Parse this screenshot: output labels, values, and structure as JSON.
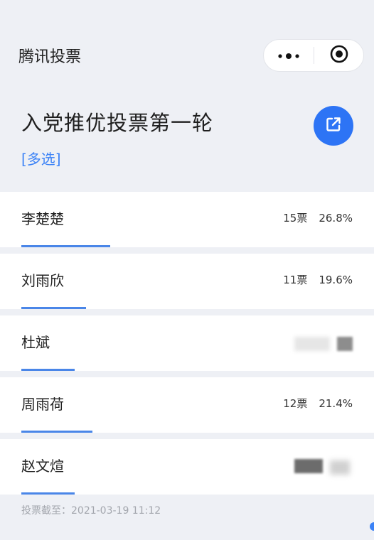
{
  "header": {
    "app_title": "腾讯投票",
    "more_icon": "more-dots-icon",
    "close_icon": "target-close-icon"
  },
  "poll": {
    "title": "入党推优投票第一轮",
    "type_label": "[多选]",
    "share_icon": "share-external-icon",
    "accent_color": "#2d74f5"
  },
  "candidates": [
    {
      "name": "李楚楚",
      "votes": "15票",
      "percent": "26.8%",
      "share": 0.268
    },
    {
      "name": "刘雨欣",
      "votes": "11票",
      "percent": "19.6%",
      "share": 0.196
    },
    {
      "name": "杜斌",
      "votes": "",
      "percent": "",
      "share": 0.16
    },
    {
      "name": "周雨荷",
      "votes": "12票",
      "percent": "21.4%",
      "share": 0.214
    },
    {
      "name": "赵文煊",
      "votes": "",
      "percent": "",
      "share": 0.16
    }
  ],
  "footer": {
    "deadline": "投票截至：2021-03-19 11:12"
  }
}
